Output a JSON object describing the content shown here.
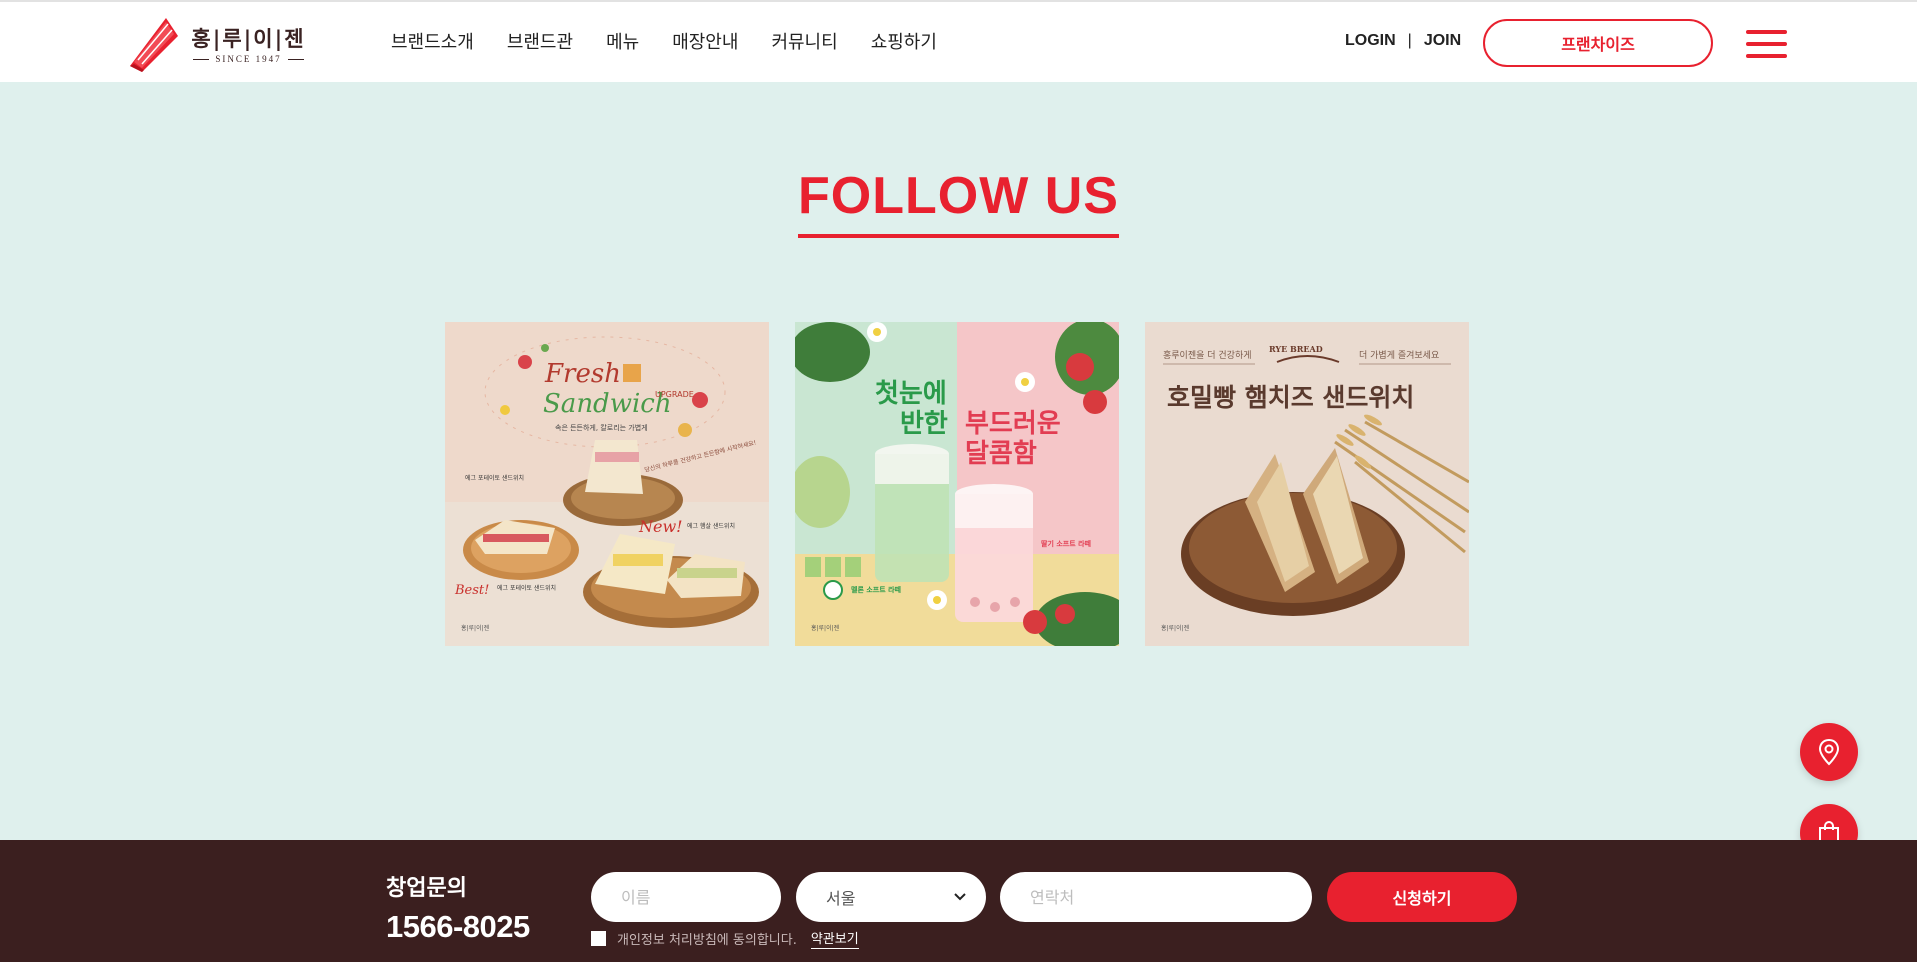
{
  "brand": {
    "logo_text": "홍|루|이|젠",
    "since": "SINCE 1947",
    "accent_color": "#e8212f",
    "dark_color": "#3b1f1f",
    "background_color": "#dff0ed"
  },
  "nav": {
    "items": [
      {
        "label": "브랜드소개"
      },
      {
        "label": "브랜드관"
      },
      {
        "label": "메뉴"
      },
      {
        "label": "매장안내"
      },
      {
        "label": "커뮤니티"
      },
      {
        "label": "쇼핑하기"
      }
    ]
  },
  "util": {
    "login": "LOGIN",
    "separator": "|",
    "join": "JOIN",
    "franchise": "프랜차이즈"
  },
  "follow": {
    "title": "FOLLOW US",
    "posts": [
      {
        "fresh": "Fresh",
        "sandwich": "Sandwich",
        "upgrade": "UPGRADE",
        "sub": "속은 든든하게, 칼로리는 가볍게",
        "note": "당신의 하루를 건강하고 든든함에 시작하세요!",
        "item1": "에그 포테이토 샌드위치",
        "new": "New!",
        "item2": "에그 햄살 샌드위치",
        "best": "Best!",
        "item3": "에그 포테이토 샌드위치",
        "logo": "홍|루|이|젠"
      },
      {
        "line1": "첫눈에",
        "line2": "반한",
        "line3": "부드러운",
        "line4": "달콤함",
        "tag1": "멜론 소프트 라떼",
        "tag2": "딸기 소프트 라떼",
        "logo": "홍|루|이|젠"
      },
      {
        "left": "홍루이젠을 더 건강하게",
        "badge": "RYE BREAD",
        "right": "더 가볍게 즐겨보세요",
        "title": "호밀빵 햄치즈 샌드위치",
        "logo": "홍|루|이|젠"
      }
    ]
  },
  "floating": {
    "location_icon": "map-pin-icon",
    "shop_icon": "shopping-bag-icon"
  },
  "inquiry": {
    "label": "창업문의",
    "phone": "1566-8025",
    "name_placeholder": "이름",
    "region_value": "서울",
    "contact_placeholder": "연락처",
    "submit": "신청하기",
    "agree_text": "개인정보 처리방침에 동의합니다.",
    "terms_link": "약관보기"
  }
}
